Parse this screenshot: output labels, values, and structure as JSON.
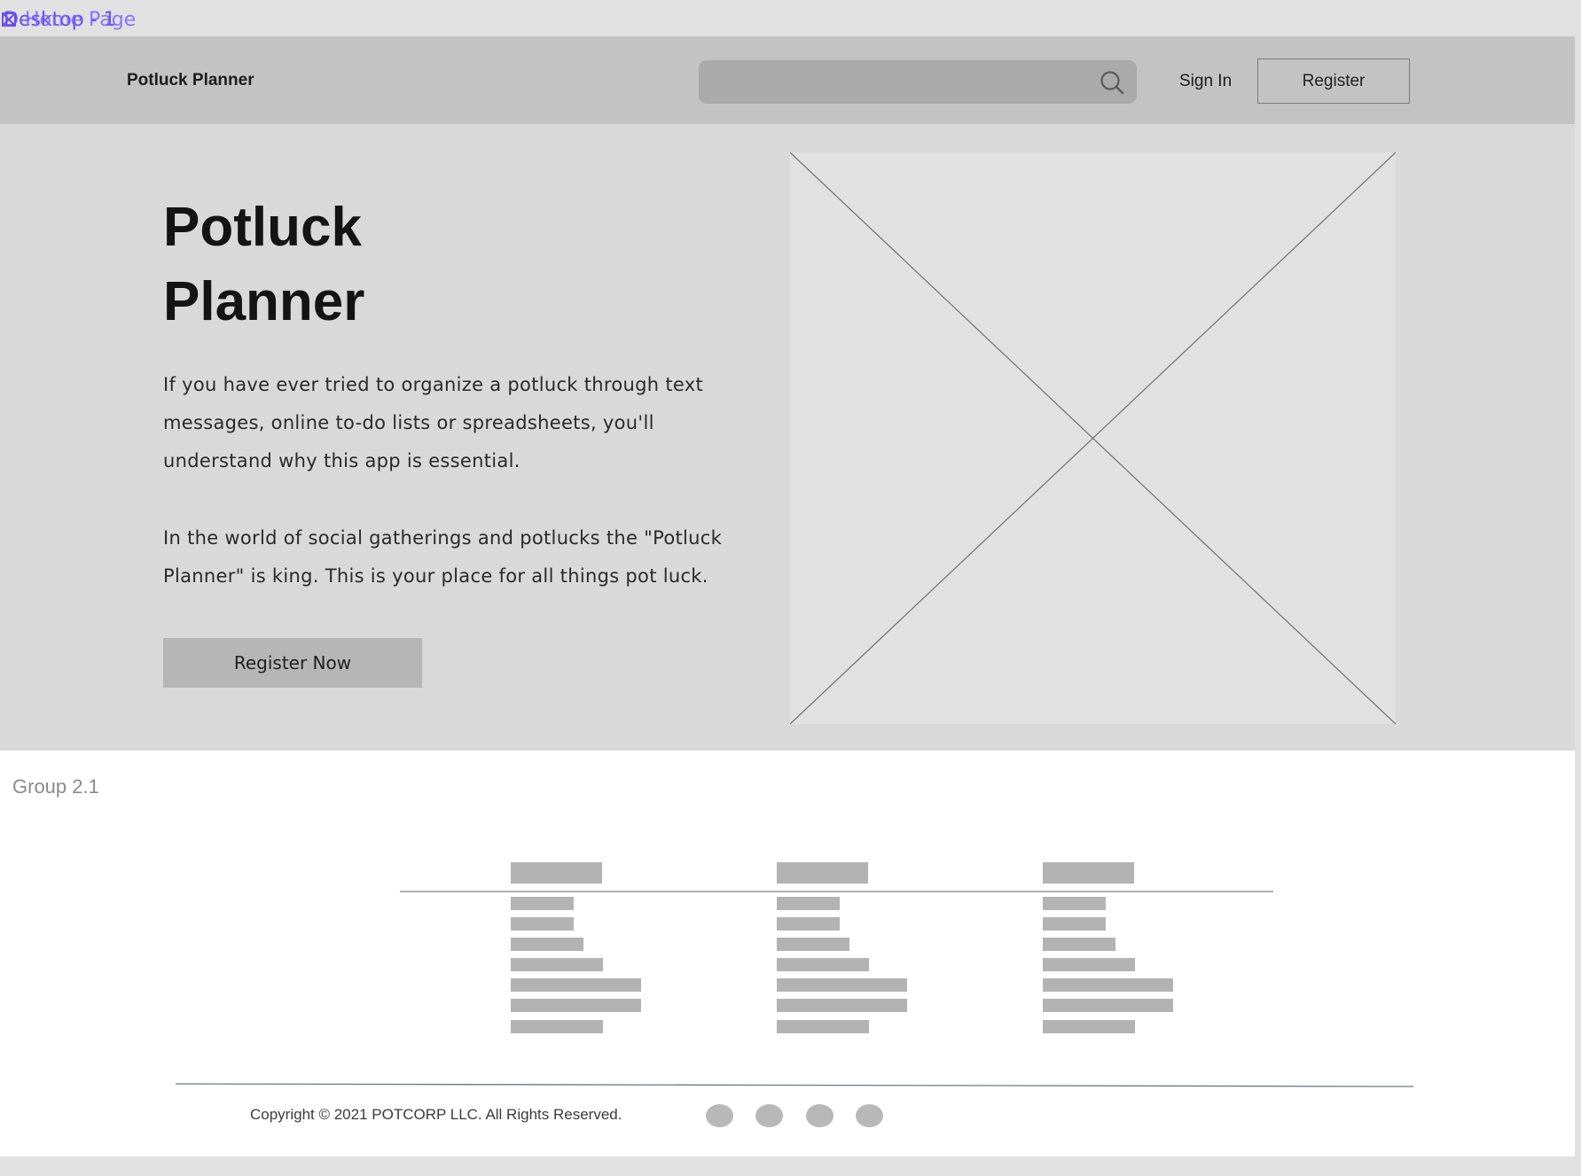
{
  "frame": {
    "label": "Desktop - 1",
    "label_overlay": "Home Page",
    "icon": "frame-icon"
  },
  "header": {
    "brand": "Potluck Planner",
    "search": {
      "placeholder": "",
      "value": "",
      "icon": "search-icon"
    },
    "sign_in": "Sign In",
    "register": "Register"
  },
  "hero": {
    "title_line1": "Potluck",
    "title_line2": "Planner",
    "paragraph1": "If you have ever tried to organize a potluck through text messages, online to-do lists or spreadsheets, you'll understand why this app is essential.",
    "paragraph2": "In the world of social gatherings and potlucks the \"Potluck Planner\" is king. This is your place for all things pot luck.",
    "cta": "Register Now",
    "image": "image-placeholder"
  },
  "footer": {
    "group_label": "Group 2.1",
    "copyright": "Copyright © 2021 POTCORP LLC. All Rights Reserved.",
    "social_icons": [
      "social-icon-1",
      "social-icon-2",
      "social-icon-3",
      "social-icon-4"
    ]
  },
  "colors": {
    "header_bg": "#c4c3c4",
    "hero_bg": "#d9d9d9",
    "placeholder_bar": "#b3b3b3",
    "frame_label": "#6a4df0"
  }
}
